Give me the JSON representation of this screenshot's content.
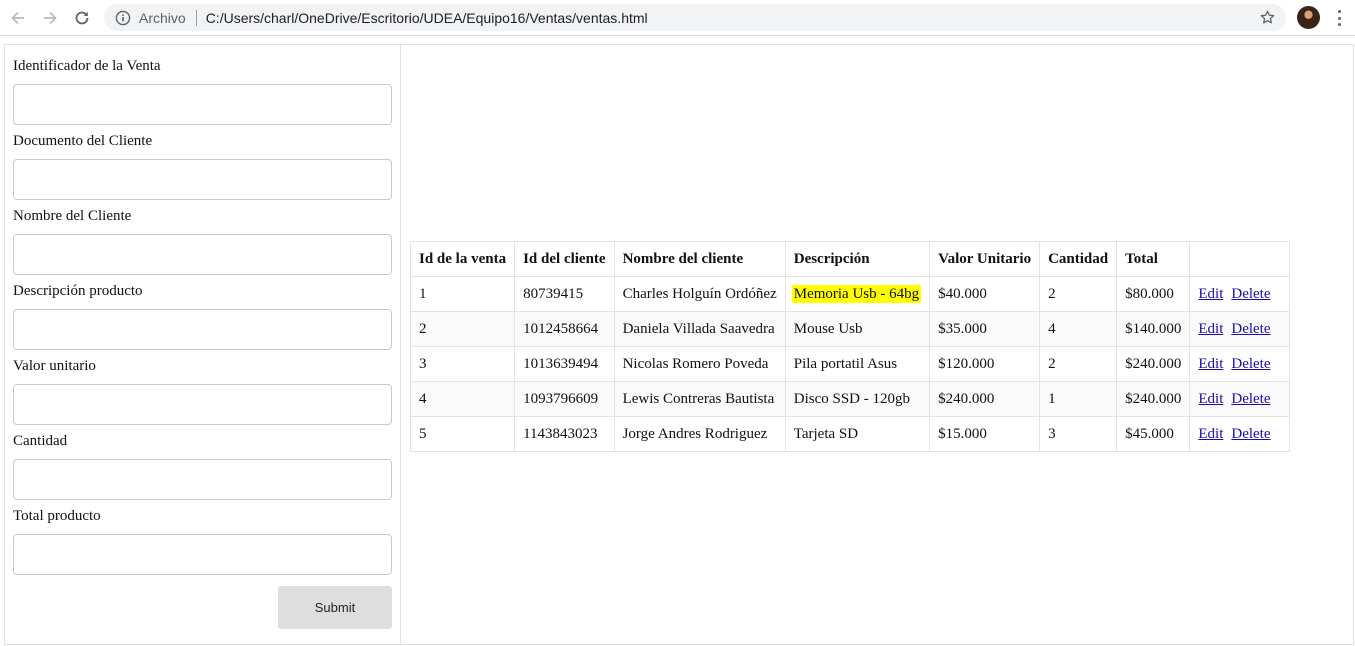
{
  "browser": {
    "address_scheme": "Archivo",
    "address_url": "C:/Users/charl/OneDrive/Escritorio/UDEA/Equipo16/Ventas/ventas.html"
  },
  "form": {
    "fields": [
      {
        "label": "Identificador de la Venta",
        "value": ""
      },
      {
        "label": "Documento del Cliente",
        "value": ""
      },
      {
        "label": "Nombre del Cliente",
        "value": ""
      },
      {
        "label": "Descripción producto",
        "value": ""
      },
      {
        "label": "Valor unitario",
        "value": ""
      },
      {
        "label": "Cantidad",
        "value": ""
      },
      {
        "label": "Total producto",
        "value": ""
      }
    ],
    "submit_label": "Submit"
  },
  "table": {
    "headers": [
      "Id de la venta",
      "Id del cliente",
      "Nombre del cliente",
      "Descripción",
      "Valor Unitario",
      "Cantidad",
      "Total",
      ""
    ],
    "rows": [
      {
        "id": "1",
        "client_id": "80739415",
        "name": "Charles Holguín Ordóñez",
        "description": "Memoria Usb - 64bg",
        "unit_price": "$40.000",
        "quantity": "2",
        "total": "$80.000",
        "highlight": true
      },
      {
        "id": "2",
        "client_id": "1012458664",
        "name": "Daniela Villada Saavedra",
        "description": "Mouse Usb",
        "unit_price": "$35.000",
        "quantity": "4",
        "total": "$140.000",
        "highlight": false
      },
      {
        "id": "3",
        "client_id": "1013639494",
        "name": "Nicolas Romero Poveda",
        "description": "Pila portatil Asus",
        "unit_price": "$120.000",
        "quantity": "2",
        "total": "$240.000",
        "highlight": false
      },
      {
        "id": "4",
        "client_id": "1093796609",
        "name": "Lewis Contreras Bautista",
        "description": "Disco SSD - 120gb",
        "unit_price": "$240.000",
        "quantity": "1",
        "total": "$240.000",
        "highlight": false
      },
      {
        "id": "5",
        "client_id": "1143843023",
        "name": "Jorge Andres Rodriguez",
        "description": "Tarjeta SD",
        "unit_price": "$15.000",
        "quantity": "3",
        "total": "$45.000",
        "highlight": false
      }
    ],
    "edit_label": "Edit",
    "delete_label": "Delete",
    "highlight_color": "#ffff00"
  }
}
